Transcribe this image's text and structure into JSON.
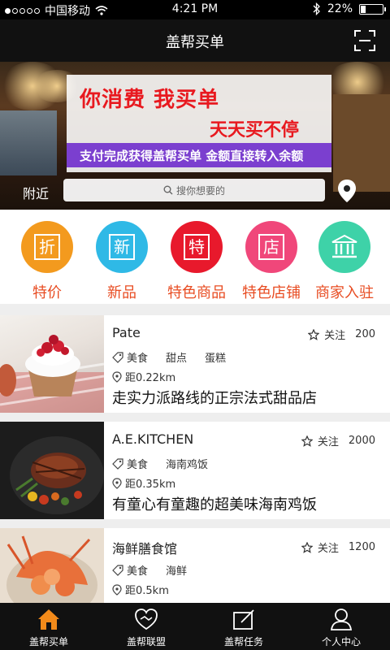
{
  "status_bar": {
    "carrier": "中国移动",
    "time": "4:21 PM",
    "battery": "22%",
    "battery_level": 0.22
  },
  "header": {
    "title": "盖帮买单",
    "scan_icon": "scan-icon"
  },
  "banner": {
    "headline": "你消费 我买单",
    "subline": "天天买不停",
    "strip_text": "支付完成获得盖帮买单 金额直接转入余额"
  },
  "search": {
    "nearby_label": "附近",
    "placeholder": "搜你想要的"
  },
  "categories": [
    {
      "label": "特价",
      "glyph": "折",
      "color": "#f39a1e"
    },
    {
      "label": "新品",
      "glyph": "新",
      "color": "#2fb9e6"
    },
    {
      "label": "特色商品",
      "glyph": "特",
      "color": "#e8192c"
    },
    {
      "label": "特色店铺",
      "glyph": "店",
      "color": "#f0477a"
    },
    {
      "label": "商家入驻",
      "glyph": "",
      "color": "#3ed2a8"
    }
  ],
  "stores": [
    {
      "name": "Pate",
      "follow_label": "关注",
      "followers": "200",
      "tags": [
        "美食",
        "甜点",
        "蛋糕"
      ],
      "distance": "距0.22km",
      "desc": "走实力派路线的正宗法式甜品店"
    },
    {
      "name": "A.E.KITCHEN",
      "follow_label": "关注",
      "followers": "2000",
      "tags": [
        "美食",
        "海南鸡饭"
      ],
      "distance": "距0.35km",
      "desc": "有童心有童趣的超美味海南鸡饭"
    },
    {
      "name": "海鲜膳食馆",
      "follow_label": "关注",
      "followers": "1200",
      "tags": [
        "美食",
        "海鲜"
      ],
      "distance": "距0.5km",
      "desc": ""
    }
  ],
  "tabs": [
    {
      "label": "盖帮买单",
      "icon": "home-icon",
      "active": true
    },
    {
      "label": "盖帮联盟",
      "icon": "handshake-icon",
      "active": false
    },
    {
      "label": "盖帮任务",
      "icon": "task-icon",
      "active": false
    },
    {
      "label": "个人中心",
      "icon": "person-icon",
      "active": false
    }
  ],
  "colors": {
    "accent_orange": "#f28a1a",
    "category_text": "#e84c22",
    "bar_bg": "#111111"
  }
}
